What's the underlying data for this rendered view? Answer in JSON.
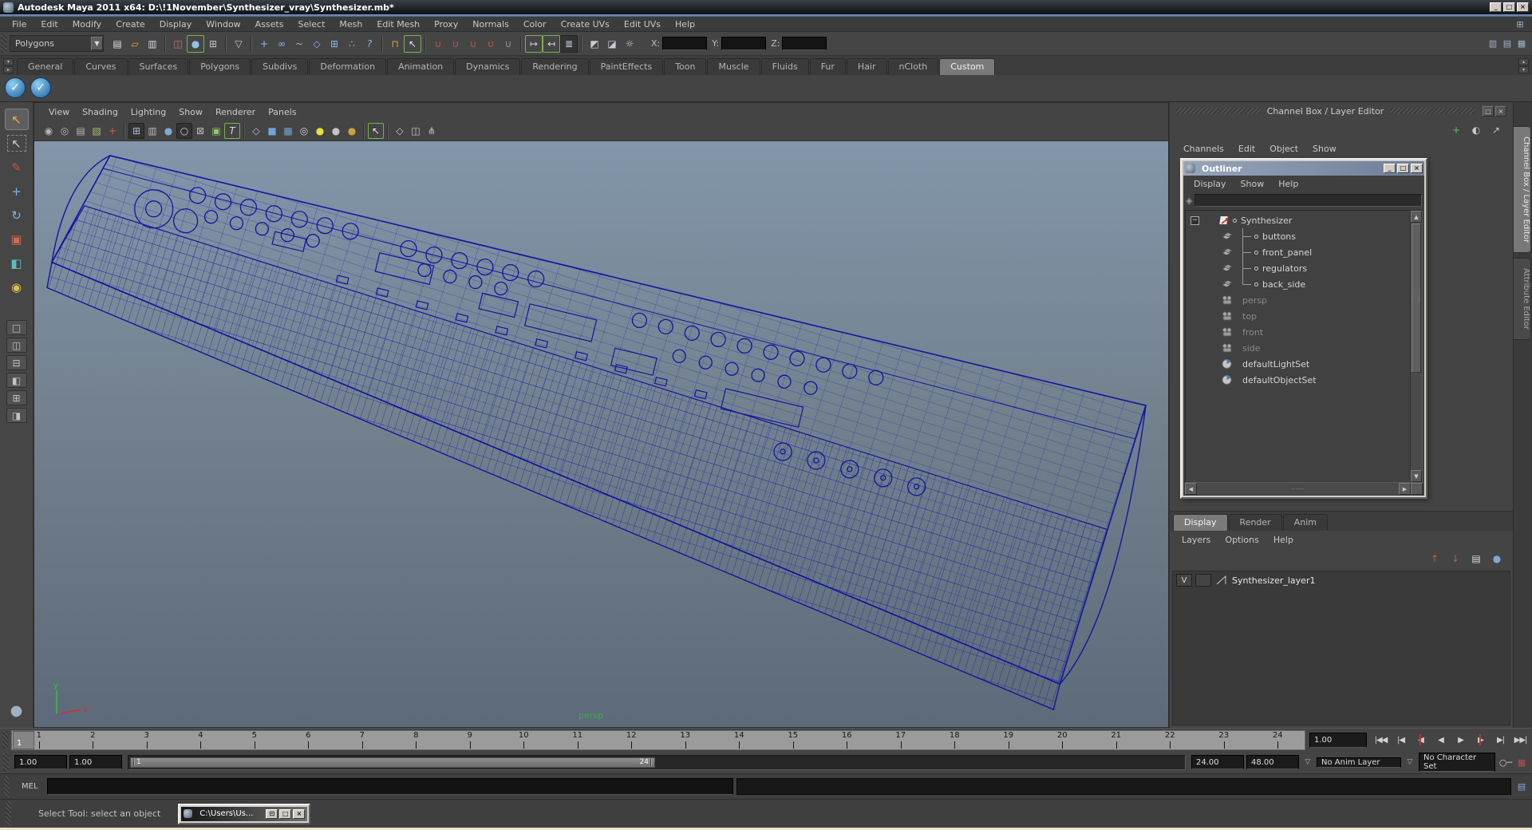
{
  "titlebar": {
    "title": "Autodesk Maya 2011 x64: D:\\!1November\\Synthesizer_vray\\Synthesizer.mb*",
    "buttons": [
      {
        "name": "minimize-button",
        "glyph": "_"
      },
      {
        "name": "maximize-button",
        "glyph": "□"
      },
      {
        "name": "close-button",
        "glyph": "×"
      }
    ]
  },
  "menubar": {
    "items": [
      "File",
      "Edit",
      "Modify",
      "Create",
      "Display",
      "Window",
      "Assets",
      "Select",
      "Mesh",
      "Edit Mesh",
      "Proxy",
      "Normals",
      "Color",
      "Create UVs",
      "Edit UVs",
      "Help"
    ],
    "right_icon": {
      "name": "workspace-grid-icon",
      "glyph": "⊞"
    }
  },
  "statusline": {
    "mode": "Polygons",
    "icons": [
      {
        "name": "new-scene-icon",
        "glyph": "▤",
        "color": "#e0ded6"
      },
      {
        "name": "open-scene-icon",
        "glyph": "▱",
        "color": "#d8a940"
      },
      {
        "name": "save-scene-icon",
        "glyph": "▥",
        "color": "#cfd4da"
      },
      {
        "sep": true
      },
      {
        "name": "select-hierarchy-icon",
        "glyph": "◫",
        "color": "#c97b6a"
      },
      {
        "name": "select-object-icon",
        "glyph": "●",
        "color": "#8fc2ea",
        "frame": true
      },
      {
        "name": "select-component-icon",
        "glyph": "⊞",
        "color": "#c8c8c8"
      },
      {
        "sep": true
      },
      {
        "name": "selection-mask-icon",
        "glyph": "▽",
        "color": "#c8c8c8"
      },
      {
        "sep": true
      },
      {
        "name": "mask-handles-icon",
        "glyph": "+",
        "color": "#8fb8e8"
      },
      {
        "name": "mask-joints-icon",
        "glyph": "∞",
        "color": "#8fb8e8"
      },
      {
        "name": "mask-curves-icon",
        "glyph": "~",
        "color": "#8fb8e8"
      },
      {
        "name": "mask-surfaces-icon",
        "glyph": "◇",
        "color": "#8fb8e8"
      },
      {
        "name": "mask-deformations-icon",
        "glyph": "⊞",
        "color": "#8fb8e8"
      },
      {
        "name": "mask-dynamics-icon",
        "glyph": "∴",
        "color": "#8fb8e8"
      },
      {
        "name": "mask-other-icon",
        "glyph": "?",
        "color": "#8fb8e8"
      },
      {
        "sep": true
      },
      {
        "name": "lock-icon",
        "glyph": "⊓",
        "color": "#d8a940"
      },
      {
        "name": "highlight-selection-icon",
        "glyph": "↖",
        "color": "#e8e8e8",
        "frame": true
      },
      {
        "sep": true
      },
      {
        "name": "snap-grid-icon",
        "glyph": "∪",
        "color": "#c0564a"
      },
      {
        "name": "snap-curve-icon",
        "glyph": "∪",
        "color": "#c0564a"
      },
      {
        "name": "snap-point-icon",
        "glyph": "∪",
        "color": "#c0564a"
      },
      {
        "name": "snap-view-plane-icon",
        "glyph": "∪",
        "color": "#c0564a"
      },
      {
        "name": "make-live-icon",
        "glyph": "∪",
        "color": "#9a9a9a"
      },
      {
        "sep": true
      },
      {
        "name": "input-connections-icon",
        "glyph": "↦",
        "color": "#d8d8d8",
        "frame": true
      },
      {
        "name": "output-connections-icon",
        "glyph": "↤",
        "color": "#d8d8d8",
        "frame": true
      },
      {
        "name": "construction-history-icon",
        "glyph": "≣",
        "color": "#cfe0f0",
        "pressed": true
      },
      {
        "sep": true
      },
      {
        "name": "render-icon",
        "glyph": "◩",
        "color": "#c8ccd4"
      },
      {
        "name": "ipr-render-icon",
        "glyph": "◪",
        "color": "#c8ccd4"
      },
      {
        "name": "render-settings-icon",
        "glyph": "☼",
        "color": "#c8ccd4"
      }
    ],
    "coords": [
      {
        "label": "X:",
        "value": ""
      },
      {
        "label": "Y:",
        "value": ""
      },
      {
        "label": "Z:",
        "value": ""
      }
    ],
    "right_icons": [
      {
        "name": "toggle-attribute-editor-icon",
        "glyph": "▥"
      },
      {
        "name": "toggle-tool-settings-icon",
        "glyph": "▤"
      },
      {
        "name": "toggle-channel-box-icon",
        "glyph": "▦"
      }
    ]
  },
  "shelf": {
    "tabs": [
      {
        "label": "General"
      },
      {
        "label": "Curves"
      },
      {
        "label": "Surfaces"
      },
      {
        "label": "Polygons"
      },
      {
        "label": "Subdivs"
      },
      {
        "label": "Deformation"
      },
      {
        "label": "Animation"
      },
      {
        "label": "Dynamics"
      },
      {
        "label": "Rendering"
      },
      {
        "label": "PaintEffects"
      },
      {
        "label": "Toon"
      },
      {
        "label": "Muscle"
      },
      {
        "label": "Fluids"
      },
      {
        "label": "Fur"
      },
      {
        "label": "Hair"
      },
      {
        "label": "nCloth"
      },
      {
        "label": "Custom",
        "active": true
      }
    ],
    "items": [
      {
        "name": "shelf-button-1",
        "glyph": "✓"
      },
      {
        "name": "shelf-button-2",
        "glyph": "✓"
      }
    ]
  },
  "toolbox": {
    "tools": [
      {
        "name": "select-tool",
        "glyph": "↖",
        "color": "#f0b14a",
        "active": true
      },
      {
        "name": "lasso-select-tool",
        "glyph": "↖",
        "color": "#d0d0d0",
        "dashed": true
      },
      {
        "name": "paint-selection-tool",
        "glyph": "✎",
        "color": "#cc4f43"
      },
      {
        "name": "move-tool",
        "glyph": "+",
        "color": "#7fb2e5"
      },
      {
        "name": "rotate-tool",
        "glyph": "↻",
        "color": "#7fb2e5"
      },
      {
        "name": "scale-tool",
        "glyph": "▣",
        "color": "#cc6a55"
      },
      {
        "name": "universal-manipulator-tool",
        "glyph": "◧",
        "color": "#5fbcbc"
      },
      {
        "name": "soft-modification-tool",
        "glyph": "◉",
        "color": "#d8c050"
      }
    ],
    "layouts": [
      {
        "name": "single-pane-layout",
        "glyph": "□"
      },
      {
        "name": "two-pane-side-layout",
        "glyph": "◫"
      },
      {
        "name": "two-pane-stacked-layout",
        "glyph": "⊟"
      },
      {
        "name": "three-pane-layout",
        "glyph": "◧"
      },
      {
        "name": "four-pane-layout",
        "glyph": "⊞"
      },
      {
        "name": "outliner-persp-layout",
        "glyph": "◨"
      }
    ],
    "sphere": {
      "name": "toolbox-sphere-icon",
      "glyph": "●",
      "color": "#9fb0c0"
    }
  },
  "viewport": {
    "menu": [
      "View",
      "Shading",
      "Lighting",
      "Show",
      "Renderer",
      "Panels"
    ],
    "icons": [
      {
        "name": "select-camera-icon",
        "glyph": "◉",
        "color": "#b8b8b8"
      },
      {
        "name": "camera-attributes-icon",
        "glyph": "◎",
        "color": "#b8b8b8"
      },
      {
        "name": "bookmark-icon",
        "glyph": "▤",
        "color": "#b8b8b8"
      },
      {
        "name": "image-plane-icon",
        "glyph": "▧",
        "color": "#a8bc78"
      },
      {
        "name": "view-cursor-icon",
        "glyph": "+",
        "color": "#cc5f4f"
      },
      {
        "sep": true
      },
      {
        "name": "grid-icon",
        "glyph": "⊞",
        "color": "#a9bdd6",
        "pressed": true
      },
      {
        "name": "film-gate-icon",
        "glyph": "▥",
        "color": "#b8b8b8"
      },
      {
        "name": "resolution-gate-icon",
        "glyph": "●",
        "color": "#7fa8d8"
      },
      {
        "name": "gate-mask-icon",
        "glyph": "○",
        "color": "#d0d0d0",
        "pressed": true
      },
      {
        "name": "field-chart-icon",
        "glyph": "⊠",
        "color": "#b8b8b8"
      },
      {
        "name": "safe-action-icon",
        "glyph": "▣",
        "color": "#8fc86a"
      },
      {
        "name": "safe-title-icon",
        "glyph": "T",
        "color": "#d8d8d8",
        "frame": true
      },
      {
        "sep": true
      },
      {
        "name": "wireframe-icon",
        "glyph": "◇",
        "color": "#b9c6d4"
      },
      {
        "name": "smooth-shade-icon",
        "glyph": "■",
        "color": "#6fa3d8"
      },
      {
        "name": "textured-icon",
        "glyph": "▩",
        "color": "#6fa3d8"
      },
      {
        "name": "use-default-material-icon",
        "glyph": "◎",
        "color": "#d0d0d0"
      },
      {
        "name": "lighting-all-icon",
        "glyph": "●",
        "color": "#e6e23e"
      },
      {
        "name": "lighting-default-icon",
        "glyph": "●",
        "color": "#c4c4c4"
      },
      {
        "name": "lighting-flat-icon",
        "glyph": "●",
        "color": "#caa23c"
      },
      {
        "sep": true
      },
      {
        "name": "isolate-select-icon",
        "glyph": "↖",
        "color": "#e8e8e8",
        "frame": true
      },
      {
        "sep": true
      },
      {
        "name": "wireframe-on-shaded-icon",
        "glyph": "◇",
        "color": "#c8c8c8"
      },
      {
        "name": "xray-icon",
        "glyph": "◫",
        "color": "#c8c8c8"
      },
      {
        "name": "plugin-objects-icon",
        "glyph": "⋔",
        "color": "#c8c8c8"
      }
    ],
    "camera_label": "persp",
    "axis": {
      "x": "x",
      "y": "y"
    }
  },
  "outliner": {
    "title": "Outliner",
    "buttons": [
      {
        "name": "minimize-button",
        "glyph": "_"
      },
      {
        "name": "maximize-button",
        "glyph": "□"
      },
      {
        "name": "close-button",
        "glyph": "×"
      }
    ],
    "menu": [
      "Display",
      "Show",
      "Help"
    ],
    "items": [
      {
        "label": "Synthesizer",
        "icon": "transform"
      },
      {
        "label": "buttons",
        "icon": "mesh",
        "branch": "tee"
      },
      {
        "label": "front_panel",
        "icon": "mesh",
        "branch": "tee"
      },
      {
        "label": "regulators",
        "icon": "mesh",
        "branch": "tee"
      },
      {
        "label": "back_side",
        "icon": "mesh",
        "branch": "elbow"
      },
      {
        "label": "persp",
        "icon": "camera",
        "dim": true
      },
      {
        "label": "top",
        "icon": "camera",
        "dim": true
      },
      {
        "label": "front",
        "icon": "camera",
        "dim": true
      },
      {
        "label": "side",
        "icon": "camera",
        "dim": true
      },
      {
        "label": "defaultLightSet",
        "icon": "set"
      },
      {
        "label": "defaultObjectSet",
        "icon": "set"
      }
    ]
  },
  "channel_box": {
    "header": "Channel Box / Layer Editor",
    "header_buttons": [
      {
        "name": "float-button",
        "glyph": "□"
      },
      {
        "name": "close-button",
        "glyph": "×"
      }
    ],
    "toolbar_icons": [
      {
        "name": "manipulator-axis-icon",
        "glyph": "+",
        "color": "#5fb85f"
      },
      {
        "name": "display-speed-icon",
        "glyph": "◐",
        "color": "#c8c8c8"
      },
      {
        "name": "pick-arrow-icon",
        "glyph": "↗",
        "color": "#c8c8c8"
      }
    ],
    "menu": [
      "Channels",
      "Edit",
      "Object",
      "Show"
    ],
    "side_tabs": [
      {
        "label": "Channel Box / Layer Editor",
        "active": true
      },
      {
        "label": "Attribute Editor"
      }
    ]
  },
  "layer_editor": {
    "tabs": [
      {
        "label": "Display",
        "active": true
      },
      {
        "label": "Render"
      },
      {
        "label": "Anim"
      }
    ],
    "menu": [
      "Layers",
      "Options",
      "Help"
    ],
    "icons": [
      {
        "name": "move-layer-up-icon",
        "glyph": "↑",
        "color": "#cc5544"
      },
      {
        "name": "move-layer-down-icon",
        "glyph": "↓",
        "color": "#cc5544"
      },
      {
        "name": "new-empty-layer-icon",
        "glyph": "▤",
        "color": "#d8d8d8"
      },
      {
        "name": "new-layer-assign-icon",
        "glyph": "●",
        "color": "#7fa8d8"
      }
    ],
    "layers": [
      {
        "visible": "V",
        "name": "Synthesizer_layer1"
      }
    ]
  },
  "time_slider": {
    "frames": [
      "1",
      "2",
      "3",
      "4",
      "5",
      "6",
      "7",
      "8",
      "9",
      "10",
      "11",
      "12",
      "13",
      "14",
      "15",
      "16",
      "17",
      "18",
      "19",
      "20",
      "21",
      "22",
      "23",
      "24"
    ],
    "current_frame": "1",
    "current_time": "1.00",
    "transport": [
      {
        "name": "go-to-start-button",
        "glyph": "|◀◀"
      },
      {
        "name": "step-back-key-button",
        "glyph": "|◀"
      },
      {
        "name": "step-back-frame-button",
        "glyph": "◀",
        "accent": true
      },
      {
        "name": "play-backwards-button",
        "glyph": "◀"
      },
      {
        "name": "play-forwards-button",
        "glyph": "▶"
      },
      {
        "name": "step-forward-frame-button",
        "glyph": "▶",
        "accent": true
      },
      {
        "name": "step-forward-key-button",
        "glyph": "▶|"
      },
      {
        "name": "go-to-end-button",
        "glyph": "▶▶|"
      }
    ]
  },
  "range_slider": {
    "playback_start": "1.00",
    "anim_start": "1.00",
    "range_bar_start": "1",
    "range_bar_end": "24",
    "playback_end": "24.00",
    "anim_end": "48.00",
    "anim_layer": "No Anim Layer",
    "character_set": "No Character Set",
    "icons": [
      {
        "name": "auto-keyframe-icon",
        "glyph": "○─",
        "color": "#cccccc"
      },
      {
        "name": "animation-preferences-icon",
        "glyph": "▦",
        "color": "#b05050"
      }
    ]
  },
  "command_line": {
    "label": "MEL",
    "input_value": ""
  },
  "help_line": {
    "status": "Select Tool: select an object",
    "mini_window": {
      "title": "C:\\Users\\Us...",
      "buttons": [
        {
          "name": "restore-button",
          "glyph": "⊡"
        },
        {
          "name": "maximize-button",
          "glyph": "□"
        },
        {
          "name": "close-button",
          "glyph": "×"
        }
      ]
    }
  },
  "colors": {
    "wireframe": "#1818a8",
    "viewport_top": "#8295aa",
    "viewport_bottom": "#5d6a79",
    "persp_label": "#4aa44a",
    "accent_red": "#b23a3a"
  }
}
